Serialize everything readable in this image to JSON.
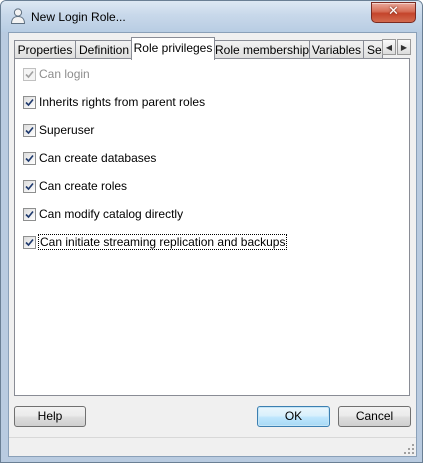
{
  "window": {
    "title": "New Login Role..."
  },
  "tabs": [
    {
      "label": "Properties",
      "active": false
    },
    {
      "label": "Definition",
      "active": false
    },
    {
      "label": "Role privileges",
      "active": true
    },
    {
      "label": "Role membership",
      "active": false
    },
    {
      "label": "Variables",
      "active": false
    },
    {
      "label": "Se",
      "active": false
    }
  ],
  "tab_scroll": {
    "left_icon": "arrow-left-icon",
    "right_icon": "arrow-right-icon"
  },
  "privileges": [
    {
      "label": "Can login",
      "checked": true,
      "enabled": false
    },
    {
      "label": "Inherits rights from parent roles",
      "checked": true,
      "enabled": true
    },
    {
      "label": "Superuser",
      "checked": true,
      "enabled": true
    },
    {
      "label": "Can create databases",
      "checked": true,
      "enabled": true
    },
    {
      "label": "Can create roles",
      "checked": true,
      "enabled": true
    },
    {
      "label": "Can modify catalog directly",
      "checked": true,
      "enabled": true
    },
    {
      "label": "Can initiate streaming replication and backups",
      "checked": true,
      "enabled": true,
      "focused": true
    }
  ],
  "buttons": {
    "help": "Help",
    "ok": "OK",
    "cancel": "Cancel"
  },
  "colors": {
    "titlebar": "#c8d8ea",
    "close_button": "#c4442b",
    "default_button": "#bee6fd",
    "check_mark": "#1f3a6e"
  }
}
